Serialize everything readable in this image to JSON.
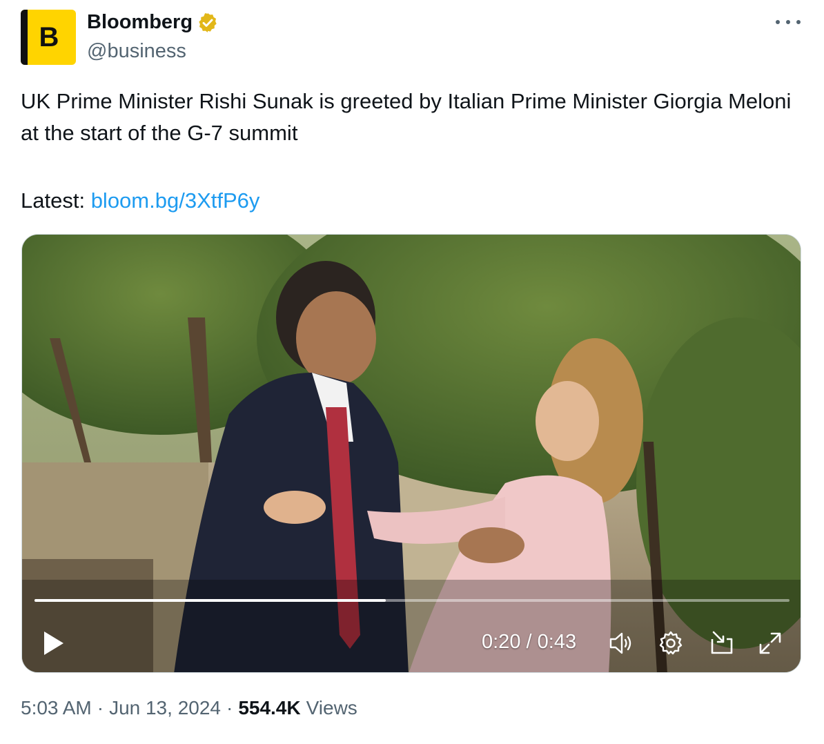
{
  "account": {
    "avatar_letter": "B",
    "name": "Bloomberg",
    "handle": "@business",
    "verified_badge": "gold-verified-badge-icon"
  },
  "tweet": {
    "text": "UK Prime Minister Rishi Sunak is greeted by Italian Prime Minister Giorgia Meloni at the start of the G-7 summit",
    "latest_label": "Latest:",
    "link_text": "bloom.bg/3XtfP6y"
  },
  "video": {
    "current_time": "0:20",
    "duration": "0:43",
    "time_display": "0:20 / 0:43",
    "progress_fraction": 0.465,
    "controls": {
      "play": "play-icon",
      "volume": "volume-icon",
      "settings": "gear-icon",
      "dock": "dock-icon",
      "fullscreen": "fullscreen-icon"
    }
  },
  "footer": {
    "time": "5:03 AM",
    "separator": "·",
    "date": "Jun 13, 2024",
    "views_count": "554.4K",
    "views_label": "Views"
  },
  "colors": {
    "link": "#1d9bf0",
    "secondary_text": "#536471",
    "primary_text": "#0f1419",
    "bloomberg_yellow": "#ffd400"
  }
}
